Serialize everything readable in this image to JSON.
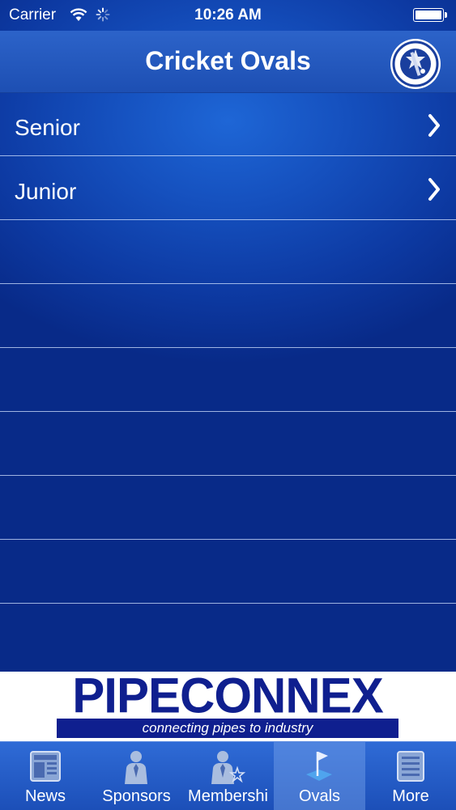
{
  "status_bar": {
    "carrier": "Carrier",
    "time": "10:26 AM"
  },
  "nav": {
    "title": "Cricket Ovals",
    "logo_icon": "maccabi-ajax-cricket-club-logo"
  },
  "list": {
    "items": [
      {
        "label": "Senior",
        "icon": "chevron-right-icon"
      },
      {
        "label": "Junior",
        "icon": "chevron-right-icon"
      }
    ]
  },
  "ad": {
    "brand": "PIPECONNEX",
    "tagline": "connecting pipes to industry"
  },
  "tabs": [
    {
      "label": "News",
      "icon": "newspaper-icon",
      "active": false
    },
    {
      "label": "Sponsors",
      "icon": "person-icon",
      "active": false
    },
    {
      "label": "Membershi",
      "icon": "members-icon",
      "active": false
    },
    {
      "label": "Ovals",
      "icon": "flag-icon",
      "active": true
    },
    {
      "label": "More",
      "icon": "list-icon",
      "active": false
    }
  ],
  "colors": {
    "background": "#0d3aa3",
    "tab_bar": "#2f6bd6",
    "ad_blue": "#0f1f8f"
  }
}
